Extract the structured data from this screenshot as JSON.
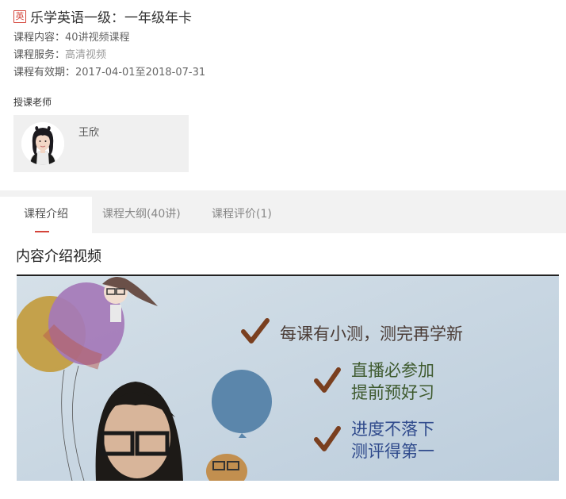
{
  "course": {
    "subject_tag": "英",
    "title": "乐学英语一级：一年级年卡",
    "content_label": "课程内容：",
    "content_value": "40讲视频课程",
    "service_label": "课程服务：",
    "service_value": "高清视频",
    "validity_label": "课程有效期：",
    "validity_value": "2017-04-01至2018-07-31"
  },
  "teacher": {
    "heading": "授课老师",
    "name": "王欣"
  },
  "tabs": [
    {
      "label": "课程介绍",
      "active": true
    },
    {
      "label": "课程大纲(40讲)",
      "active": false
    },
    {
      "label": "课程评价(1)",
      "active": false
    }
  ],
  "intro": {
    "section_title": "内容介绍视频",
    "video_lines": [
      "每课有小测，测完再学新",
      "直播必参加",
      "提前预好习",
      "进度不落下",
      "测评得第一"
    ]
  },
  "colors": {
    "accent": "#d4443a",
    "video_bg": "#c9d7e3",
    "video_text_dark": "#4a3b35",
    "video_text_green": "#3e5a2e",
    "video_text_blue": "#2f4a8c"
  },
  "icons": {
    "subject_tag": "english-subject-badge",
    "check_marks": "check-mark-icon"
  }
}
